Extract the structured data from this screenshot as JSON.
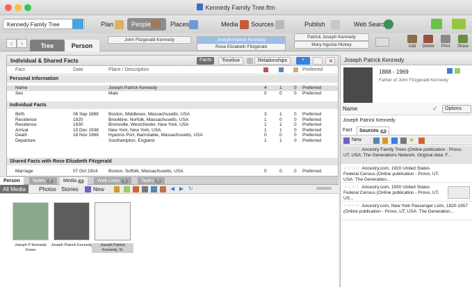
{
  "window": {
    "title": "Kennedy Family Tree.ftm"
  },
  "toolbar": {
    "tree_select": "Kennedy Family Tree",
    "plan": "Plan",
    "people": "People",
    "places": "Places",
    "media": "Media",
    "sources": "Sources",
    "publish": "Publish",
    "web_search": "Web Search"
  },
  "nav": {
    "tab_tree": "Tree",
    "tab_person": "Person",
    "father_combo": "John Fitzgerald Kennedy",
    "person_combo": "Joseph Patrick Kennedy",
    "spouse_combo": "Rose Elizabeth Fitzgerald",
    "parent1_combo": "Patrick Joseph Kennedy",
    "parent2_combo": "Mary Agusta Hickey",
    "add": "Add",
    "delete": "Delete",
    "print": "Print",
    "share": "Share"
  },
  "facts": {
    "header": "Individual & Shared Facts",
    "btn_facts": "Facts",
    "btn_timeline": "Timeline",
    "btn_relationships": "Relationships",
    "columns": {
      "fact": "Fact",
      "date": "Date",
      "place": "Place / Description",
      "preferred": "Preferred"
    },
    "groups": {
      "personal": "Personal Information",
      "individual": "Individual Facts",
      "shared": "Shared Facts with Rose Elizabeth Fitzgerald"
    },
    "personal_rows": [
      {
        "fact": "Name",
        "date": "",
        "place": "Joseph Patrick Kennedy",
        "s": "4",
        "m": "1",
        "n": "0",
        "pref": "Preferred"
      },
      {
        "fact": "Sex",
        "date": "",
        "place": "Male",
        "s": "0",
        "m": "0",
        "n": "0",
        "pref": "Preferred"
      }
    ],
    "individual_rows": [
      {
        "fact": "Birth",
        "date": "06 Sep 1888",
        "place": "Boston, Middlesex, Massachusetts, USA",
        "s": "3",
        "m": "1",
        "n": "0",
        "pref": "Preferred"
      },
      {
        "fact": "Residence",
        "date": "1920",
        "place": "Brookline, Norfolk, Massachusetts, USA",
        "s": "1",
        "m": "0",
        "n": "0",
        "pref": "Preferred"
      },
      {
        "fact": "Residence",
        "date": "1930",
        "place": "Bronxville, Westchester, New York, USA",
        "s": "1",
        "m": "1",
        "n": "0",
        "pref": "Preferred"
      },
      {
        "fact": "Arrival",
        "date": "15 Dec 1938",
        "place": "New York, New York, USA",
        "s": "1",
        "m": "1",
        "n": "0",
        "pref": "Preferred"
      },
      {
        "fact": "Death",
        "date": "18 Nov 1969",
        "place": "Hyannis Port, Barnstable, Massachusetts, USA",
        "s": "0",
        "m": "0",
        "n": "0",
        "pref": "Preferred"
      },
      {
        "fact": "Departure",
        "date": "",
        "place": "Southampton, England",
        "s": "1",
        "m": "1",
        "n": "0",
        "pref": "Preferred"
      }
    ],
    "shared_rows": [
      {
        "fact": "Marriage",
        "date": "07 Oct 1914",
        "place": "Boston, Suffolk, Massachusetts, USA",
        "s": "0",
        "m": "0",
        "n": "0",
        "pref": "Preferred"
      }
    ]
  },
  "media": {
    "tab_person": "Person",
    "tab_notes": "Notes",
    "notes_count": "2",
    "tab_media": "Media",
    "media_count": "3",
    "tab_weblinks": "Web Links",
    "weblinks_count": "1",
    "tab_tasks": "Tasks",
    "tasks_count": "0",
    "filter_all": "All Media",
    "filter_photos": "Photos",
    "filter_stories": "Stories",
    "new": "New",
    "items": [
      {
        "caption": "Joseph P Kennedy Grave"
      },
      {
        "caption": "Joseph Patrick Kennedy"
      },
      {
        "caption": "Joseph Patrick Kennedy, Sr"
      }
    ]
  },
  "right": {
    "header": "Joseph Patrick Kennedy",
    "years": "1888 - 1969",
    "relation": "Father of John Fitzgerald Kennedy",
    "name_label": "Name",
    "options": "Options",
    "name_value": "Joseph Patrick Kennedy",
    "tab_fact": "Fact",
    "tab_sources": "Sources",
    "sources_count": "4",
    "new": "New",
    "stars": "☆☆☆☆",
    "sources": [
      {
        "text": "Ancestry Family Trees (Online publication - Provo, UT, USA: The Generations Network. Original data: F..."
      },
      {
        "text": "Ancestry.com, 1920 United States Federal Census (Online publication - Provo, UT, USA: The Generation..."
      },
      {
        "text": "Ancestry.com, 1930 United States Federal Census (Online publication - Provo, UT, US..."
      },
      {
        "text": "Ancestry.com, New York Passenger Lists, 1820-1957 (Online publication - Provo, UT, USA: The Generation..."
      }
    ]
  },
  "colors": {
    "accent": "#3b7fd6",
    "selected_combo": "#9cc0ec",
    "active_tab": "#8d8d8d"
  }
}
